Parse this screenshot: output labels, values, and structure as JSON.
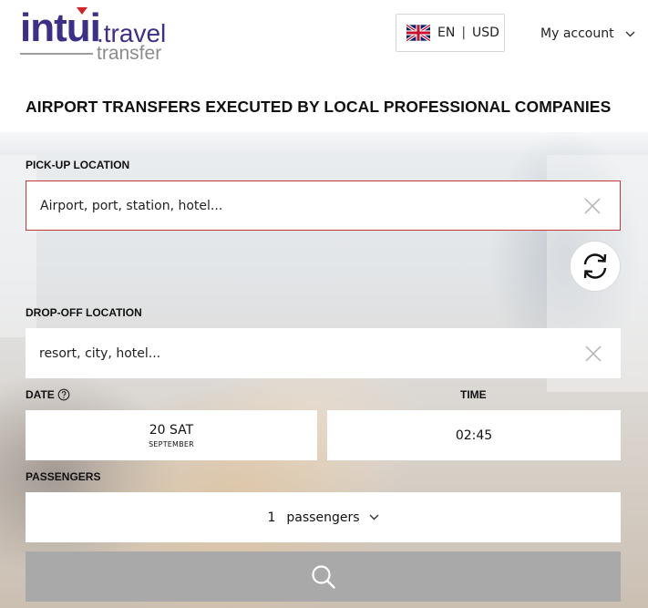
{
  "header": {
    "logo": {
      "brand": "intui",
      "travel": ".travel",
      "transfer": "transfer"
    },
    "language": "EN",
    "currency": "USD",
    "separator": "|",
    "account_label": "My account"
  },
  "headline": "AIRPORT TRANSFERS EXECUTED BY LOCAL PROFESSIONAL COMPANIES",
  "form": {
    "pickup": {
      "label": "PICK-UP LOCATION",
      "placeholder": "Airport, port, station, hotel..."
    },
    "dropoff": {
      "label": "DROP-OFF LOCATION",
      "placeholder": "resort, city, hotel..."
    },
    "date": {
      "label": "DATE",
      "day": "20 SAT",
      "month": "SEPTEMBER"
    },
    "time": {
      "label": "TIME",
      "value": "02:45"
    },
    "passengers": {
      "label": "PASSENGERS",
      "count": "1",
      "unit": "passengers"
    }
  },
  "icons": {
    "flag": "uk-flag-icon",
    "account_chevron": "chevron-down-icon",
    "clear": "close-icon",
    "swap": "swap-arrows-icon",
    "help": "question-circle-icon",
    "search": "search-icon"
  },
  "colors": {
    "brand": "#3b2f8a",
    "pickup_border": "#c0393b",
    "search_button": "#a9a9a9"
  }
}
